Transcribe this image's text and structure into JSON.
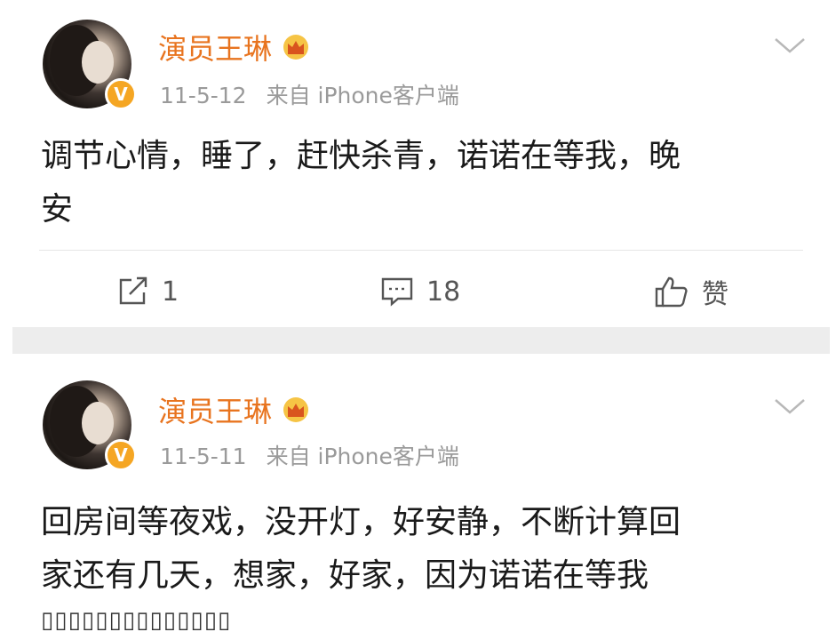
{
  "posts": [
    {
      "username": "演员王琳",
      "date": "11-5-12",
      "source": "来自 iPhone客户端",
      "content_lines": [
        "调节心情，睡了，赶快杀青，诺诺在等我，晚",
        "安"
      ],
      "actions": {
        "share_count": "1",
        "comment_count": "18",
        "like_label": "赞"
      },
      "verified_badge": "V"
    },
    {
      "username": "演员王琳",
      "date": "11-5-11",
      "source": "来自 iPhone客户端",
      "content_lines": [
        "回房间等夜戏，没开灯，好安静，不断计算回",
        "家还有几天，想家，好家，因为诺诺在等我",
        "▯▯▯▯▯▯▯▯▯▯▯▯▯▯"
      ],
      "verified_badge": "V"
    }
  ],
  "colors": {
    "username": "#e8741f",
    "badge": "#f5a623",
    "meta": "#9a9a9a",
    "separator": "#ededed"
  },
  "icons": {
    "crown": "crown-icon",
    "chevron": "chevron-down-icon",
    "share": "share-icon",
    "comment": "comment-icon",
    "like": "thumbs-up-icon"
  }
}
